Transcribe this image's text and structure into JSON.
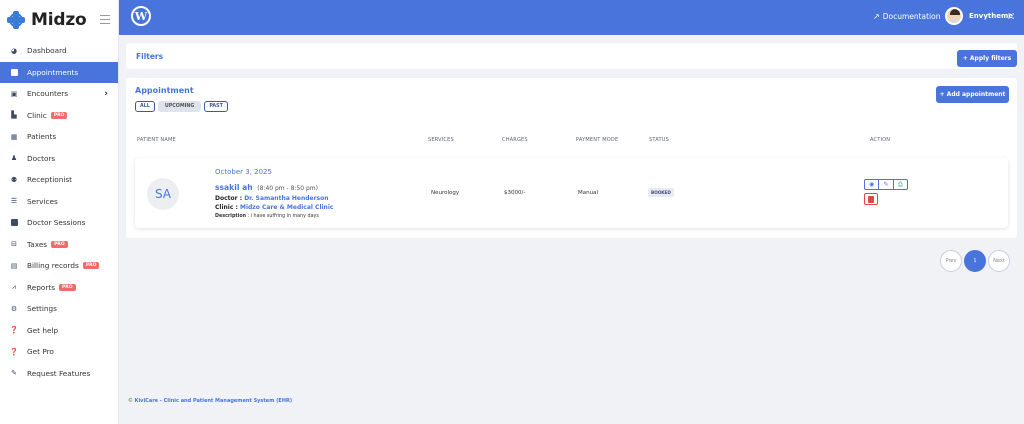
{
  "brand": {
    "name": "Midzo"
  },
  "sidebar": {
    "items": [
      {
        "label": "Dashboard",
        "icon": "dashboard-icon"
      },
      {
        "label": "Appointments",
        "icon": "calendar-icon",
        "active": true
      },
      {
        "label": "Encounters",
        "icon": "calendar-check-icon",
        "chevron": true
      },
      {
        "label": "Clinic",
        "icon": "hospital-icon",
        "badge": "PRO"
      },
      {
        "label": "Patients",
        "icon": "patients-icon"
      },
      {
        "label": "Doctors",
        "icon": "doctor-icon"
      },
      {
        "label": "Receptionist",
        "icon": "users-icon"
      },
      {
        "label": "Services",
        "icon": "list-icon"
      },
      {
        "label": "Doctor Sessions",
        "icon": "calendar-icon"
      },
      {
        "label": "Taxes",
        "icon": "tax-icon",
        "badge": "PRO"
      },
      {
        "label": "Billing records",
        "icon": "file-icon",
        "badge": "PRO"
      },
      {
        "label": "Reports",
        "icon": "chart-icon",
        "badge": "PRO"
      },
      {
        "label": "Settings",
        "icon": "gears-icon"
      },
      {
        "label": "Get help",
        "icon": "help-icon"
      },
      {
        "label": "Get Pro",
        "icon": "help-icon"
      },
      {
        "label": "Request Features",
        "icon": "edit-icon"
      }
    ]
  },
  "topbar": {
    "documentation": "Documentation",
    "user_name": "Envytheme",
    "accent": "#4874dc"
  },
  "filters": {
    "title": "Filters",
    "apply_label": "+ Apply filters"
  },
  "appointment": {
    "title": "Appointment",
    "tabs": [
      "ALL",
      "UPCOMING",
      "PAST"
    ],
    "add_label": "+ Add appointment",
    "columns": [
      "PATIENT NAME",
      "SERVICES",
      "CHARGES",
      "PAYMENT MODE",
      "STATUS",
      "ACTION"
    ],
    "rows": [
      {
        "initials": "SA",
        "date": "October 3, 2025",
        "patient": "ssakil ah",
        "time": "(8:40 pm - 8:50 pm)",
        "doctor_label": "Doctor : ",
        "doctor": "Dr. Samantha Henderson",
        "clinic_label": "Clinic : ",
        "clinic": "Midzo Care & Medical Clinic",
        "description_label": "Description",
        "description": " : i have suffring in many days",
        "service": "Neurology",
        "charges": "$3000/-",
        "payment_mode": "Manual",
        "status": "BOOKED"
      }
    ]
  },
  "pagination": {
    "prev": "Prev",
    "current": "1",
    "next": "Next"
  },
  "footer": {
    "copyright": "©",
    "text": "KiviCare - Clinic and Patient Management System (EHR)"
  }
}
